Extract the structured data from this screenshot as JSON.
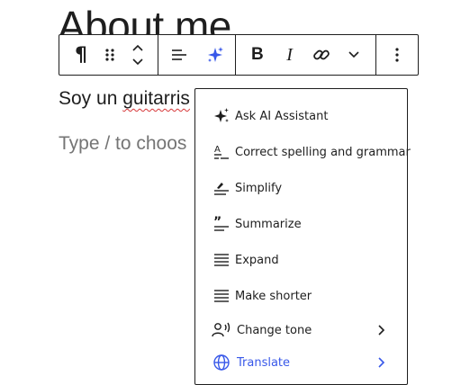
{
  "heading": {
    "text": "About me"
  },
  "paragraph": {
    "before": "Soy un ",
    "misspelled": "guitarris"
  },
  "placeholder": {
    "text": "Type / to choos"
  },
  "toolbar": {
    "icons": [
      "paragraph-icon",
      "drag-handle-icon",
      "move-up-icon",
      "move-down-icon",
      "align-icon",
      "ai-sparkle-icon",
      "bold-icon",
      "italic-icon",
      "link-icon",
      "more-rich-text-icon",
      "options-icon"
    ],
    "bold_label": "B",
    "italic_label": "I",
    "pilcrow": "¶"
  },
  "menu": {
    "items": [
      {
        "label": "Ask AI Assistant",
        "icon": "sparkle-icon"
      },
      {
        "label": "Correct spelling and grammar",
        "icon": "spellcheck-icon"
      },
      {
        "label": "Simplify",
        "icon": "simplify-icon"
      },
      {
        "label": "Summarize",
        "icon": "quote-icon"
      },
      {
        "label": "Expand",
        "icon": "expand-lines-icon"
      },
      {
        "label": "Make shorter",
        "icon": "shorter-lines-icon"
      },
      {
        "label": "Change tone",
        "icon": "tone-icon",
        "submenu": true
      },
      {
        "label": "Translate",
        "icon": "globe-icon",
        "submenu": true
      }
    ]
  },
  "colors": {
    "accent": "#3858e9",
    "spell_error": "#d63638",
    "text": "#1e1e1e",
    "placeholder": "#757575"
  }
}
